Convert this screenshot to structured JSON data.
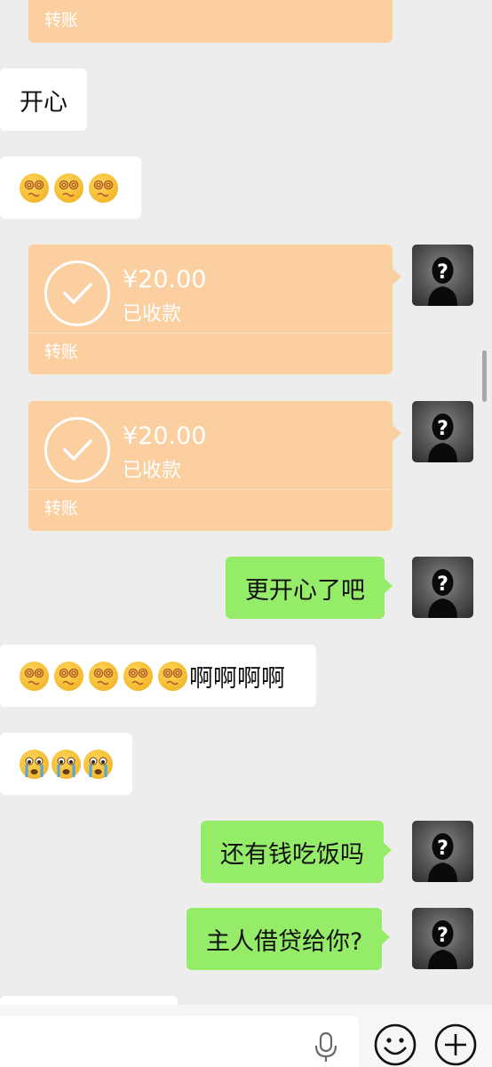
{
  "messages": {
    "transfer_top_label": "转账",
    "text_in_1": "开心",
    "transfer_1": {
      "amount": "¥20.00",
      "status": "已收款",
      "label": "转账"
    },
    "transfer_2": {
      "amount": "¥20.00",
      "status": "已收款",
      "label": "转账"
    },
    "text_out_1": "更开心了吧",
    "text_in_3_suffix": "啊啊啊啊",
    "text_out_2": "还有钱吃饭吗",
    "text_out_3": "主人借贷给你?"
  },
  "colors": {
    "background": "#ededed",
    "incoming_bubble": "#ffffff",
    "outgoing_bubble": "#95ec69",
    "transfer_bubble": "#fbcfa0"
  },
  "icons": {
    "dizzy_emoji": "dizzy-face-emoji",
    "crying_emoji": "crying-face-emoji",
    "avatar": "silhouette-question-avatar",
    "mic": "mic-icon",
    "emoji_button": "smiley-icon",
    "plus_button": "plus-icon"
  }
}
